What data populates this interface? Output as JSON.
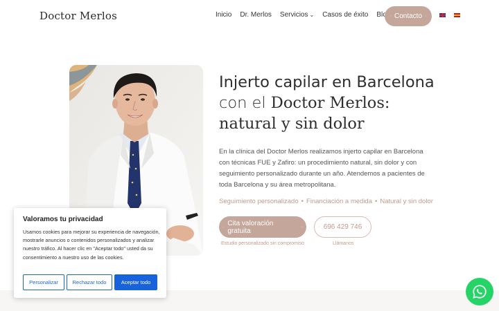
{
  "header": {
    "logo": "Doctor Merlos",
    "nav": [
      {
        "label": "Inicio"
      },
      {
        "label": "Dr. Merlos"
      },
      {
        "label": "Servicios"
      },
      {
        "label": "Casos de éxito"
      },
      {
        "label": "Blog"
      }
    ],
    "contact_label": "Contacto",
    "languages": [
      "en-flag-icon",
      "es-flag-icon"
    ]
  },
  "hero": {
    "title_line1": "Injerto capilar en Barcelona",
    "title_line2_plain": "con el ",
    "title_line2_em": "Doctor Merlos:",
    "title_line3": "natural y sin dolor",
    "description": "En la clínica del Doctor Merlos realizamos injerto capilar en Barcelona con técnicas FUE y Zafiro: un procedimiento natural, sin dolor y con seguimiento personalizado durante un año. Atendemos a pacientes de toda Barcelona y su área metropolitana.",
    "features": [
      "Seguimiento personalizado",
      "Financiación a medida",
      "Natural y sin dolor"
    ],
    "cta_label": "Cita valoración gratuita",
    "cta_sub": "Estudio personalizado sin compromiso",
    "phone_label": "696 429 746",
    "phone_sub": "Llámanos"
  },
  "cookie": {
    "title": "Valoramos tu privacidad",
    "text": "Usamos cookies para mejorar su experiencia de navegación, mostrarle anuncios o contenidos personalizados y analizar nuestro tráfico. Al hacer clic en \"Aceptar todo\" usted da su consentimiento a nuestro uso de las cookies.",
    "customize_label": "Personalizar",
    "reject_label": "Rechazar todo",
    "accept_label": "Aceptar todo"
  },
  "colors": {
    "accent": "#c5a69a",
    "cookie_blue": "#1863dc",
    "whatsapp": "#25d366"
  }
}
